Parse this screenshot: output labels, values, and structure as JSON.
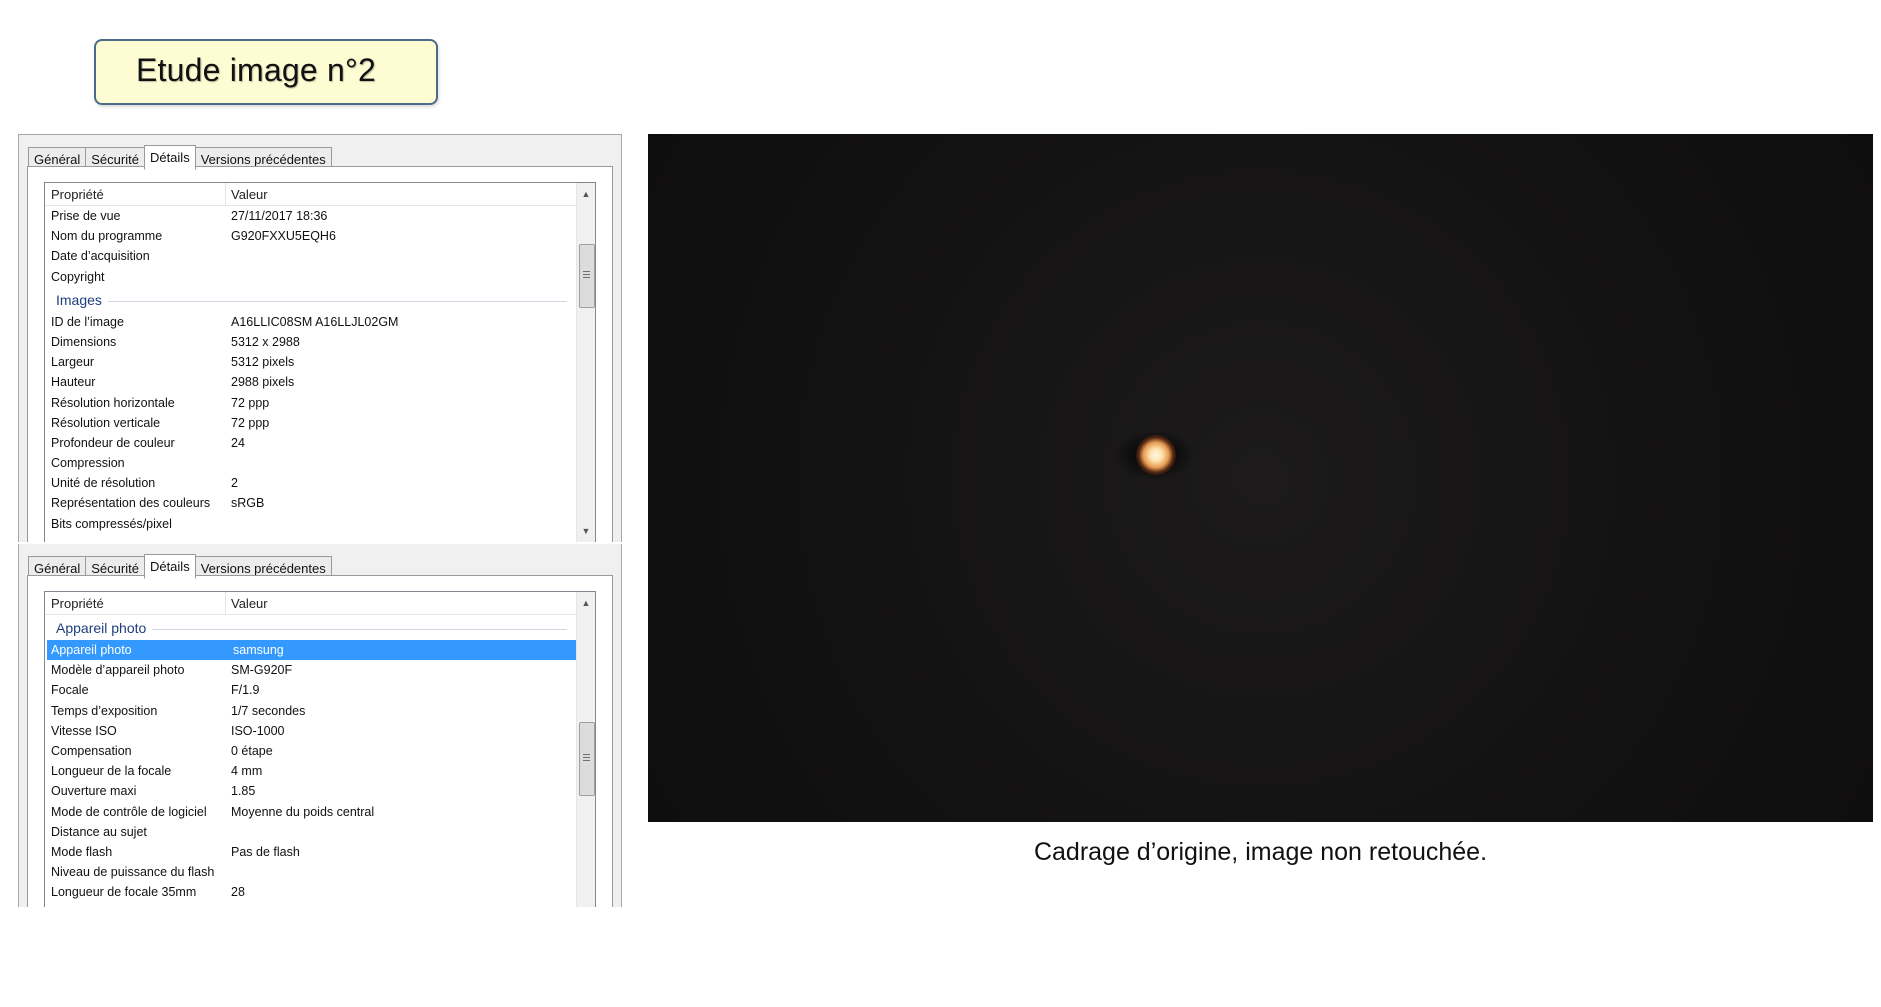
{
  "title": "Etude image n°2",
  "panel_top": {
    "tabs": [
      "Général",
      "Sécurité",
      "Détails",
      "Versions précédentes"
    ],
    "active_tab": "Détails",
    "columns": [
      "Propriété",
      "Valeur"
    ],
    "items": [
      {
        "k": "Prise de vue",
        "v": "27/11/2017 18:36"
      },
      {
        "k": "Nom du programme",
        "v": "G920FXXU5EQH6"
      },
      {
        "k": "Date d’acquisition",
        "v": ""
      },
      {
        "k": "Copyright",
        "v": ""
      },
      {
        "group": "Images"
      },
      {
        "k": "ID de l’image",
        "v": "A16LLIC08SM A16LLJL02GM"
      },
      {
        "k": "Dimensions",
        "v": "5312 x 2988"
      },
      {
        "k": "Largeur",
        "v": "5312 pixels"
      },
      {
        "k": "Hauteur",
        "v": "2988 pixels"
      },
      {
        "k": "Résolution horizontale",
        "v": "72 ppp"
      },
      {
        "k": "Résolution verticale",
        "v": "72 ppp"
      },
      {
        "k": "Profondeur de couleur",
        "v": "24"
      },
      {
        "k": "Compression",
        "v": ""
      },
      {
        "k": "Unité de résolution",
        "v": "2"
      },
      {
        "k": "Représentation des couleurs",
        "v": "sRGB"
      },
      {
        "k": "Bits compressés/pixel",
        "v": ""
      }
    ]
  },
  "panel_bottom": {
    "tabs": [
      "Général",
      "Sécurité",
      "Détails",
      "Versions précédentes"
    ],
    "active_tab": "Détails",
    "columns": [
      "Propriété",
      "Valeur"
    ],
    "items": [
      {
        "group": "Appareil photo"
      },
      {
        "k": "Appareil photo",
        "v": "samsung",
        "selected": true
      },
      {
        "k": "Modèle d’appareil photo",
        "v": "SM-G920F"
      },
      {
        "k": "Focale",
        "v": "F/1.9"
      },
      {
        "k": "Temps d’exposition",
        "v": "1/7 secondes"
      },
      {
        "k": "Vitesse ISO",
        "v": "ISO-1000"
      },
      {
        "k": "Compensation",
        "v": "0 étape"
      },
      {
        "k": "Longueur de la focale",
        "v": "4 mm"
      },
      {
        "k": "Ouverture maxi",
        "v": "1.85"
      },
      {
        "k": "Mode de contrôle de logiciel",
        "v": "Moyenne du poids central"
      },
      {
        "k": "Distance au sujet",
        "v": ""
      },
      {
        "k": "Mode flash",
        "v": "Pas de flash"
      },
      {
        "k": "Niveau de puissance du flash",
        "v": ""
      },
      {
        "k": "Longueur de focale 35mm",
        "v": "28"
      }
    ]
  },
  "caption": "Cadrage d’origine, image non retouchée.",
  "icons": {
    "scroll_up": "scroll-up-arrow-icon",
    "scroll_down": "scroll-down-arrow-icon"
  },
  "colors": {
    "selection": "#3399ff",
    "title_box_bg": "#fdfcd3",
    "group_text": "#1e3e7a"
  }
}
